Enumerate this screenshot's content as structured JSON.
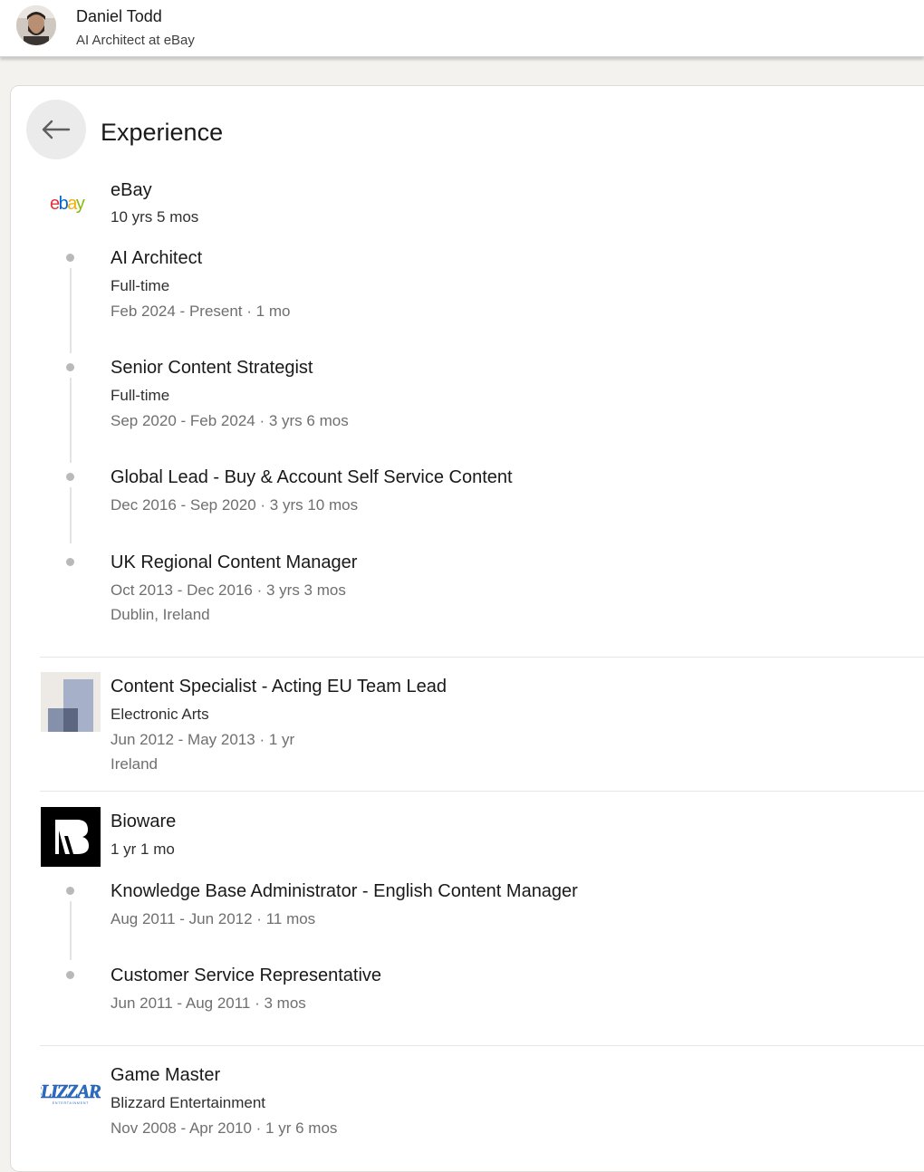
{
  "header": {
    "name": "Daniel Todd",
    "headline": "AI Architect at eBay"
  },
  "section": {
    "title": "Experience",
    "back_icon": "arrow-left-icon"
  },
  "experience": [
    {
      "company": "eBay",
      "logo": "ebay-logo",
      "logo_text": "ebay",
      "duration": "10 yrs 5 mos",
      "roles": [
        {
          "title": "AI Architect",
          "type": "Full-time",
          "dates": "Feb 2024 - Present · 1 mo"
        },
        {
          "title": "Senior Content Strategist",
          "type": "Full-time",
          "dates": "Sep 2020 - Feb 2024 · 3 yrs 6 mos"
        },
        {
          "title": "Global Lead - Buy & Account Self Service Content",
          "dates": "Dec 2016 - Sep 2020 · 3 yrs 10 mos"
        },
        {
          "title": "UK Regional Content Manager",
          "dates": "Oct 2013 - Dec 2016 · 3 yrs 3 mos",
          "location": "Dublin, Ireland"
        }
      ]
    },
    {
      "title": "Content Specialist - Acting EU Team Lead",
      "company": "Electronic Arts",
      "logo": "company-placeholder-logo",
      "dates": "Jun 2012 - May 2013 · 1 yr",
      "location": "Ireland"
    },
    {
      "company": "Bioware",
      "logo": "bioware-logo",
      "duration": "1 yr 1 mo",
      "roles": [
        {
          "title": "Knowledge Base Administrator - English Content Manager",
          "dates": "Aug 2011 - Jun 2012 · 11 mos"
        },
        {
          "title": "Customer Service Representative",
          "dates": "Jun 2011 - Aug 2011 · 3 mos"
        }
      ]
    },
    {
      "title": "Game Master",
      "company": "Blizzard Entertainment",
      "logo": "blizzard-logo",
      "logo_text": "BLIZZARD",
      "logo_subtext": "ENTERTAINMENT",
      "dates": "Nov 2008 - Apr 2010 · 1 yr 6 mos"
    }
  ],
  "colors": {
    "page_bg": "#f4f2ee",
    "card_bg": "#ffffff",
    "ebay_red": "#e53238",
    "ebay_blue": "#0064d2",
    "ebay_yellow": "#f5af02",
    "ebay_green": "#86b817",
    "blizzard_blue": "#148eff"
  }
}
